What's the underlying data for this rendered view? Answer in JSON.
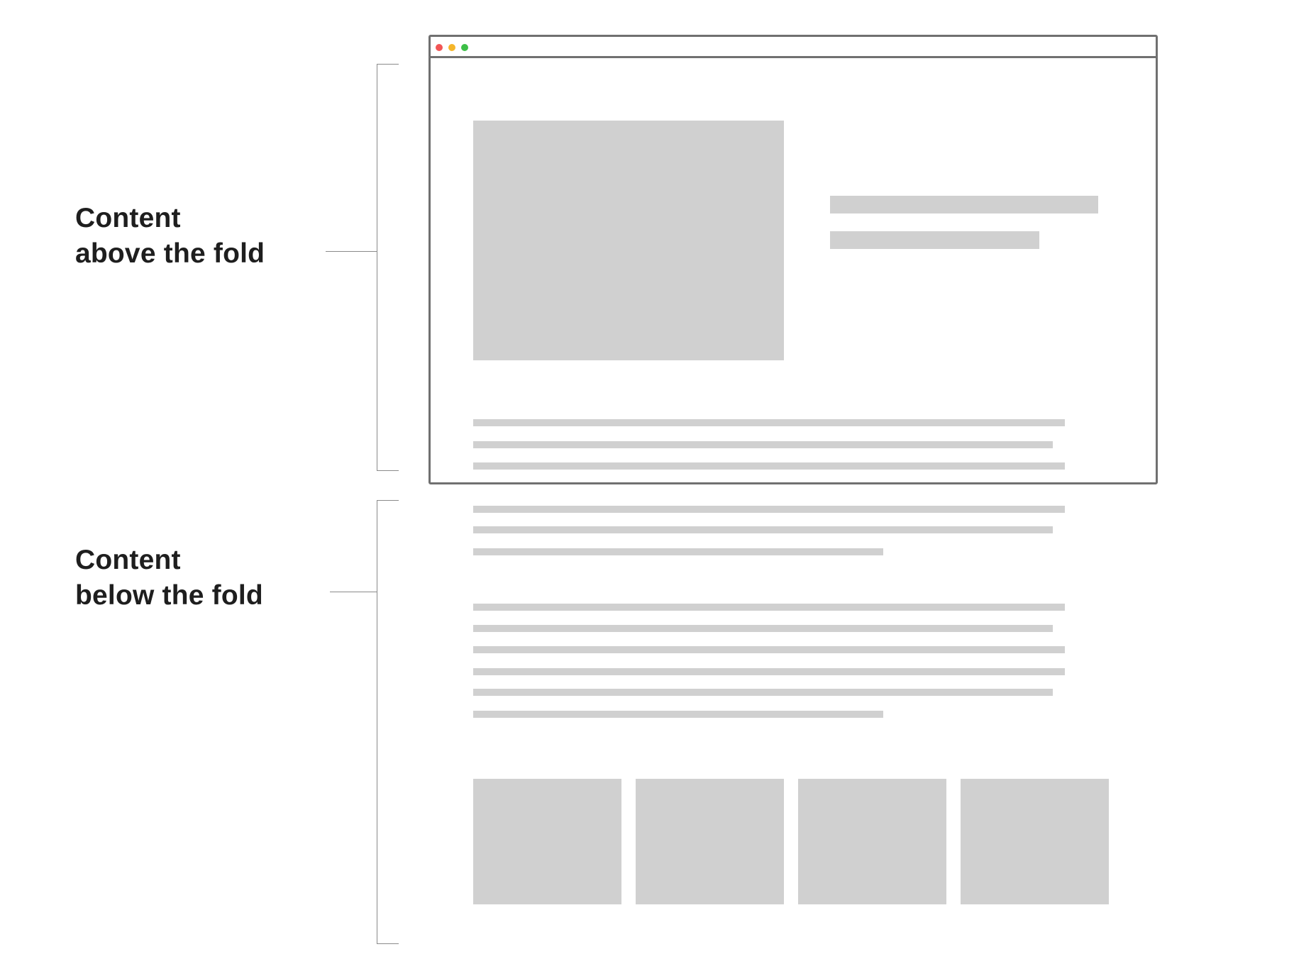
{
  "labels": {
    "above_fold": {
      "line1": "Content",
      "line2": "above the fold"
    },
    "below_fold": {
      "line1": "Content",
      "line2": "below the fold"
    }
  },
  "colors": {
    "text": "#1e1e1e",
    "bracket": "#8a8a8a",
    "browser_frame": "#707070",
    "placeholder": "#d0d0d0",
    "dot_close": "#f25555",
    "dot_minimize": "#f5b62a",
    "dot_maximize": "#3dbf47"
  }
}
